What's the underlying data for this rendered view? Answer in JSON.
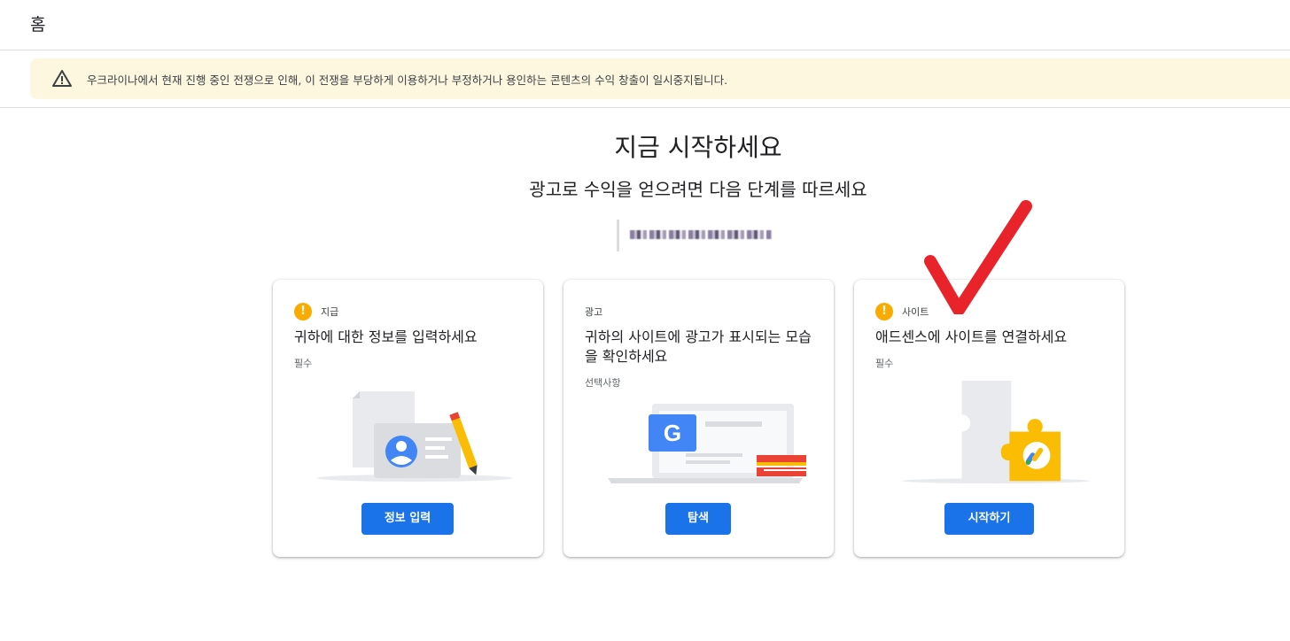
{
  "header": {
    "title": "홈"
  },
  "banner": {
    "icon": "warning-triangle-icon",
    "message": "우크라이나에서 현재 진행 중인 전쟁으로 인해, 이 전쟁을 부당하게 이용하거나 부정하거나 용인하는 콘텐츠의 수익 창출이 일시중지됩니다."
  },
  "main": {
    "heading": "지금 시작하세요",
    "subheading": "광고로 수익을 얻으려면 다음 단계를 따르세요"
  },
  "cards": [
    {
      "tag": "지급",
      "title": "귀하에 대한 정보를 입력하세요",
      "requirement": "필수",
      "button": "정보 입력",
      "icon": "alert-icon"
    },
    {
      "tag": "광고",
      "title": "귀하의 사이트에 광고가 표시되는 모습을 확인하세요",
      "requirement": "선택사항",
      "button": "탐색"
    },
    {
      "tag": "사이트",
      "title": "애드센스에 사이트를 연결하세요",
      "requirement": "필수",
      "button": "시작하기",
      "icon": "alert-icon"
    }
  ],
  "colors": {
    "accent": "#1a73e8",
    "warning": "#f9ab00",
    "banner_bg": "#fef7e0",
    "checkmark": "#e8232a"
  }
}
